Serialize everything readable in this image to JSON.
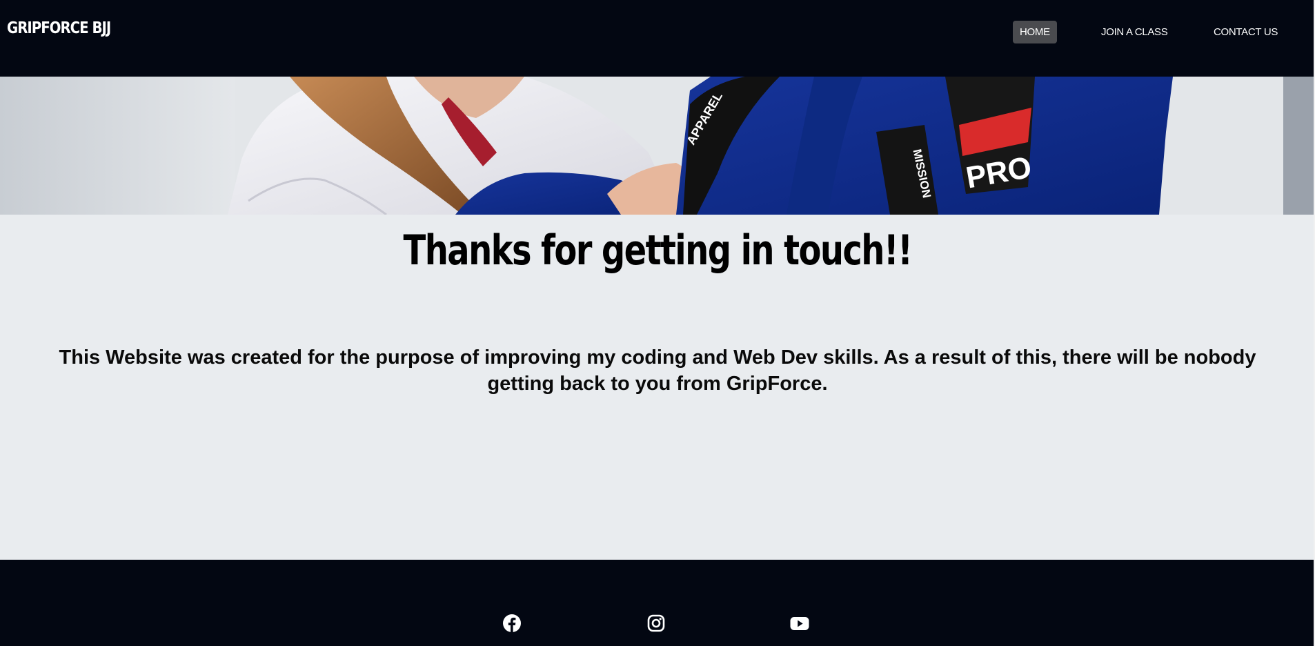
{
  "nav": {
    "brand": "GRIPFORCE BJJ",
    "links": [
      {
        "label": "HOME",
        "active": true
      },
      {
        "label": "JOIN A CLASS",
        "active": false
      },
      {
        "label": "CONTACT US",
        "active": false
      }
    ]
  },
  "hero": {
    "lapel_texts": [
      "APPAREL",
      "MISSION"
    ],
    "patch_text": "PRO"
  },
  "main": {
    "heading": "Thanks for getting in touch!!",
    "message": "This Website was created for the purpose of improving my coding and Web Dev skills. As a result of this, there will be nobody getting back to you from GripForce."
  },
  "footer": {
    "social": [
      {
        "icon": "facebook-icon"
      },
      {
        "icon": "instagram-icon"
      },
      {
        "icon": "youtube-icon"
      }
    ]
  },
  "colors": {
    "navbar": "#030712",
    "page_background": "#e9ecef",
    "active_nav": "#4a4b4f",
    "gi_blue": "#0f2d8a",
    "gi_white": "#f2f2f5"
  }
}
